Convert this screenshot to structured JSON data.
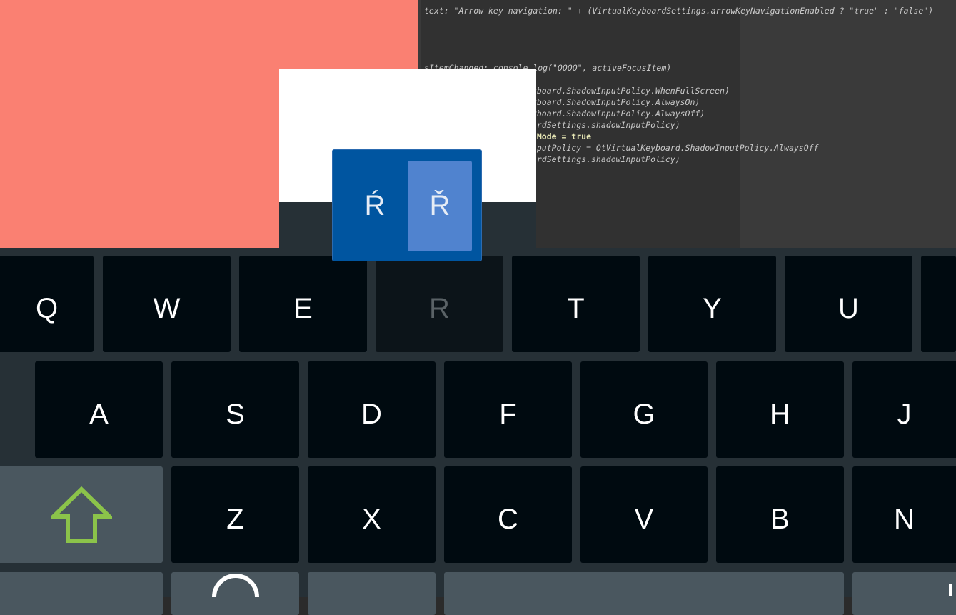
{
  "editor": {
    "lines": [
      "text: \"Arrow key navigation: \" + (VirtualKeyboardSettings.arrowKeyNavigationEnabled ? \"true\" : \"false\")",
      "sItemChanged: console.log(\"QQQQ\", activeFocusItem)",
      "eyboard.ShadowInputPolicy.WhenFullScreen)",
      "eyboard.ShadowInputPolicy.AlwaysOn)",
      "eyboard.ShadowInputPolicy.AlwaysOff)",
      "oardSettings.shadowInputPolicy)",
      "enMode = true",
      "InputPolicy = QtVirtualKeyboard.ShadowInputPolicy.AlwaysOff",
      "oardSettings.shadowInputPolicy)"
    ]
  },
  "popup": {
    "alternates": [
      "Ŕ",
      "Ř"
    ],
    "selected_index": 1
  },
  "keyboard": {
    "row1": [
      "Q",
      "W",
      "E",
      "R",
      "T",
      "Y",
      "U"
    ],
    "row2": [
      "A",
      "S",
      "D",
      "F",
      "G",
      "H",
      "J"
    ],
    "row3": [
      "Z",
      "X",
      "C",
      "V",
      "B",
      "N"
    ],
    "pressed_key": "R",
    "shift_icon_color": "#8bc34a"
  },
  "colors": {
    "background_panel": "#fa8072",
    "key_bg": "#000a10",
    "keyboard_bg": "#263036",
    "popup_bg": "#0055a0",
    "popup_selected": "#5083cf"
  }
}
